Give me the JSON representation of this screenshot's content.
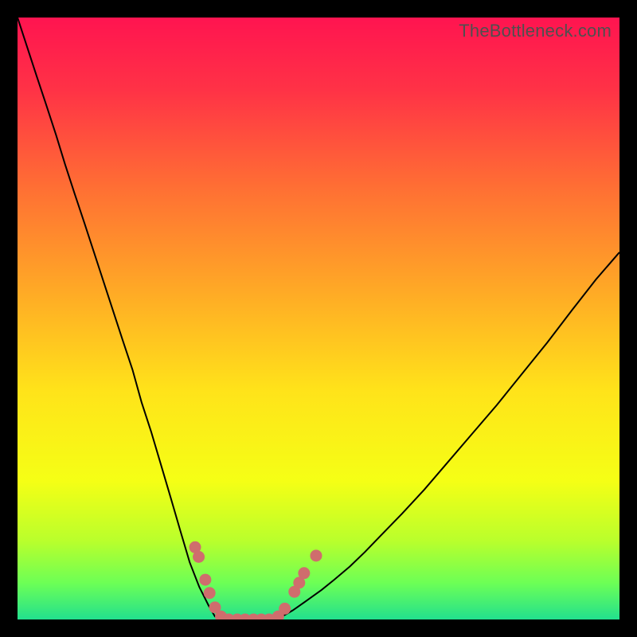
{
  "watermark": "TheBottleneck.com",
  "chart_data": {
    "type": "line",
    "title": "",
    "xlabel": "",
    "ylabel": "",
    "xlim": [
      0,
      100
    ],
    "ylim": [
      0,
      100
    ],
    "background_gradient": {
      "stops": [
        {
          "offset": 0.0,
          "color": "#ff1450"
        },
        {
          "offset": 0.12,
          "color": "#ff3246"
        },
        {
          "offset": 0.28,
          "color": "#ff6e34"
        },
        {
          "offset": 0.45,
          "color": "#ffa826"
        },
        {
          "offset": 0.62,
          "color": "#ffe31a"
        },
        {
          "offset": 0.77,
          "color": "#f5ff15"
        },
        {
          "offset": 0.87,
          "color": "#b9ff2c"
        },
        {
          "offset": 0.94,
          "color": "#6cff56"
        },
        {
          "offset": 1.0,
          "color": "#22e08e"
        }
      ]
    },
    "series": [
      {
        "name": "left-curve",
        "x": [
          0.0,
          1.6,
          3.2,
          4.8,
          6.4,
          7.9,
          9.5,
          11.1,
          12.7,
          14.3,
          15.9,
          17.5,
          19.1,
          20.6,
          22.2,
          23.8,
          25.4,
          27.0,
          28.6,
          30.2,
          31.8,
          32.8,
          33.9
        ],
        "y": [
          100.0,
          95.1,
          90.2,
          85.4,
          80.5,
          75.6,
          70.7,
          65.9,
          61.0,
          56.1,
          51.2,
          46.3,
          41.5,
          36.1,
          31.2,
          25.8,
          20.4,
          14.9,
          9.5,
          5.4,
          2.2,
          0.5,
          0.0
        ]
      },
      {
        "name": "right-curve",
        "x": [
          43.0,
          44.3,
          45.7,
          47.0,
          48.4,
          50.5,
          52.6,
          55.2,
          57.7,
          60.3,
          63.9,
          67.6,
          71.2,
          75.4,
          79.6,
          83.8,
          88.0,
          92.2,
          96.1,
          100.0
        ],
        "y": [
          0.0,
          0.7,
          1.5,
          2.4,
          3.4,
          4.9,
          6.6,
          8.8,
          11.2,
          13.9,
          17.6,
          21.6,
          25.8,
          30.7,
          35.6,
          40.8,
          46.0,
          51.5,
          56.5,
          61.0
        ]
      },
      {
        "name": "bottom-connector",
        "x": [
          33.9,
          35.4,
          36.9,
          38.5,
          40.2,
          41.6,
          43.0
        ],
        "y": [
          0.0,
          0.0,
          0.0,
          0.0,
          0.0,
          0.0,
          0.0
        ]
      }
    ],
    "markers": {
      "name": "salmon-dots",
      "color": "#cf6d6d",
      "points": [
        {
          "x": 29.5,
          "y": 12.0
        },
        {
          "x": 30.1,
          "y": 10.4
        },
        {
          "x": 31.2,
          "y": 6.6
        },
        {
          "x": 31.9,
          "y": 4.4
        },
        {
          "x": 32.8,
          "y": 2.0
        },
        {
          "x": 33.8,
          "y": 0.5
        },
        {
          "x": 35.1,
          "y": 0.0
        },
        {
          "x": 36.5,
          "y": 0.0
        },
        {
          "x": 37.8,
          "y": 0.0
        },
        {
          "x": 39.2,
          "y": 0.0
        },
        {
          "x": 40.5,
          "y": 0.0
        },
        {
          "x": 41.8,
          "y": 0.0
        },
        {
          "x": 43.3,
          "y": 0.5
        },
        {
          "x": 44.4,
          "y": 1.8
        },
        {
          "x": 46.0,
          "y": 4.6
        },
        {
          "x": 46.8,
          "y": 6.1
        },
        {
          "x": 47.6,
          "y": 7.7
        },
        {
          "x": 49.6,
          "y": 10.6
        }
      ]
    }
  }
}
